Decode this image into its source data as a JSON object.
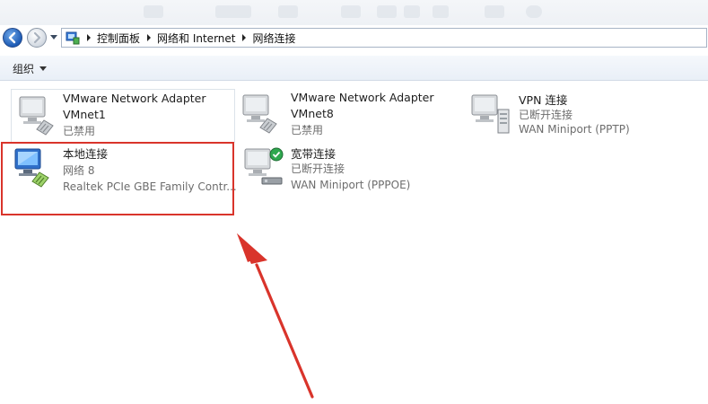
{
  "address_bar": {
    "breadcrumbs": [
      "控制面板",
      "网络和 Internet",
      "网络连接"
    ]
  },
  "command_bar": {
    "organize_label": "组织"
  },
  "connections": [
    {
      "name_line1": "VMware Network Adapter",
      "name_line2": "VMnet1",
      "status": "已禁用",
      "device": "",
      "icon": "network-adapter-disabled-icon"
    },
    {
      "name_line1": "VMware Network Adapter",
      "name_line2": "VMnet8",
      "status": "已禁用",
      "device": "",
      "icon": "network-adapter-disabled-icon"
    },
    {
      "name_line1": "VPN 连接",
      "name_line2": "",
      "status": "已断开连接",
      "device": "WAN Miniport (PPTP)",
      "icon": "vpn-connection-icon"
    },
    {
      "name_line1": "本地连接",
      "name_line2": "",
      "status": "网络  8",
      "device": "Realtek PCIe GBE Family Contr...",
      "icon": "local-area-connection-icon"
    },
    {
      "name_line1": "宽带连接",
      "name_line2": "",
      "status": "已断开连接",
      "device": "WAN Miniport (PPPOE)",
      "icon": "broadband-connection-icon"
    }
  ],
  "annotation": {
    "highlight_color": "#d9342b",
    "arrow_color": "#d9342b"
  }
}
